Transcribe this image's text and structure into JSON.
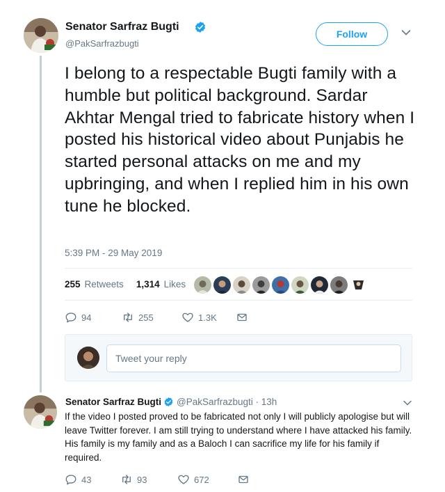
{
  "tweet": {
    "author_name": "Senator Sarfraz Bugti",
    "handle": "@PakSarfrazbugti",
    "follow_label": "Follow",
    "text": "I belong to a respectable Bugti family with a humble but political background. Sardar Akhtar Mengal tried to fabricate history when I posted his historical video about Punjabis he started personal attacks on me and my upbringing, and when I replied him in his own tune he blocked.",
    "timestamp": "5:39 PM - 29 May 2019",
    "retweets_count": "255",
    "retweets_label": "Retweets",
    "likes_count": "1,314",
    "likes_label": "Likes",
    "actions": {
      "replies": "94",
      "retweets": "255",
      "likes": "1.3K"
    }
  },
  "reply_composer": {
    "placeholder": "Tweet your reply"
  },
  "reply_tweet": {
    "author_name": "Senator Sarfraz Bugti",
    "meta": "@PakSarfrazbugti · 13h",
    "text": "If the video I posted proved to be fabricated not only I will publicly apologise but will leave Twitter forever. I am still trying to understand where I have attacked his family. His family is my family and as a Baloch I can sacrifice my life for his family if required.",
    "actions": {
      "replies": "43",
      "retweets": "93",
      "likes": "672"
    }
  },
  "colors": {
    "accent": "#1da1f2",
    "muted": "#657786",
    "text": "#14171a",
    "thread_line": "#c4cfd6"
  }
}
